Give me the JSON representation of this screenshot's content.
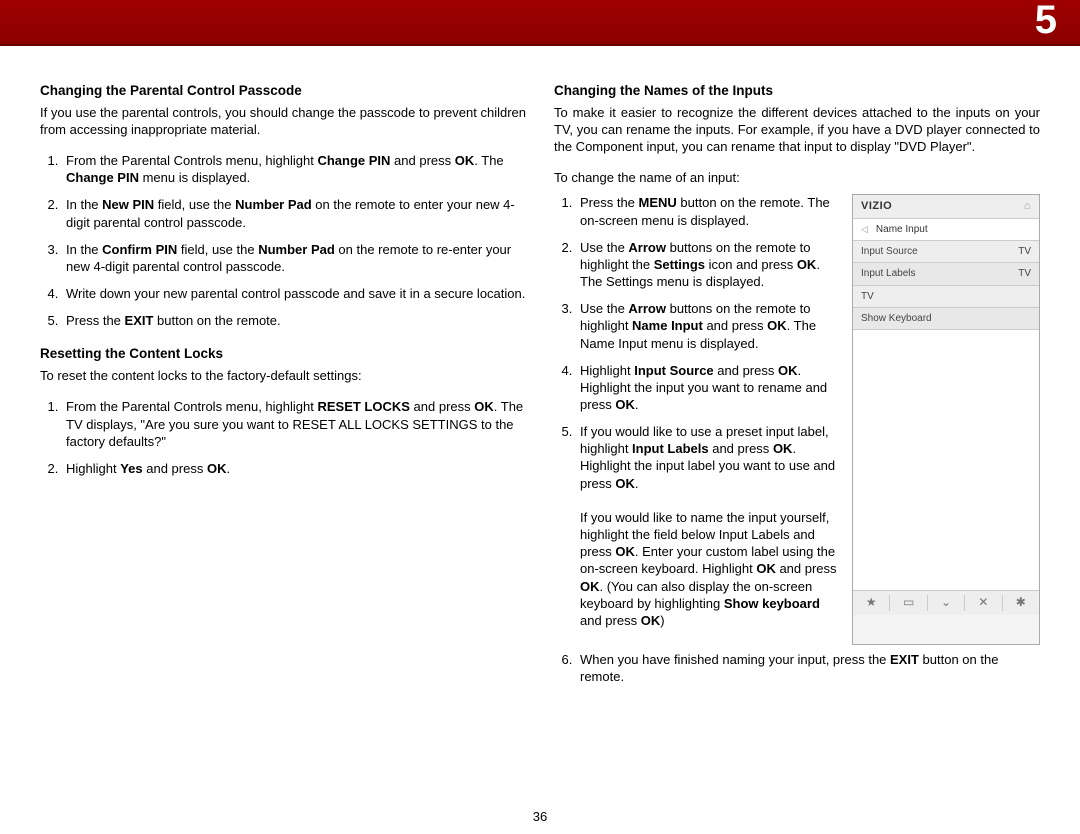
{
  "chapter_number": "5",
  "page_number": "36",
  "left": {
    "sec1_title": "Changing the Parental Control Passcode",
    "sec1_intro": "If you use the parental controls, you should change the passcode to prevent children from accessing inappropriate material.",
    "sec1_li1_a": "From the Parental Controls menu, highlight ",
    "sec1_li1_b": "Change PIN",
    "sec1_li1_c": " and press ",
    "sec1_li1_d": "OK",
    "sec1_li1_e": ". The ",
    "sec1_li1_f": "Change PIN",
    "sec1_li1_g": " menu is displayed.",
    "sec1_li2_a": "In the ",
    "sec1_li2_b": "New PIN",
    "sec1_li2_c": " field, use the ",
    "sec1_li2_d": "Number Pad",
    "sec1_li2_e": " on the remote to enter your new 4-digit parental control passcode.",
    "sec1_li3_a": "In the ",
    "sec1_li3_b": "Confirm PIN",
    "sec1_li3_c": " field, use the ",
    "sec1_li3_d": "Number Pad",
    "sec1_li3_e": " on the remote to re-enter your new 4-digit parental control passcode.",
    "sec1_li4": "Write down your new parental control passcode and save it in a secure location.",
    "sec1_li5_a": "Press the ",
    "sec1_li5_b": "EXIT",
    "sec1_li5_c": " button on the remote.",
    "sec2_title": "Resetting the Content Locks",
    "sec2_intro": "To reset the content locks to the factory-default settings:",
    "sec2_li1_a": "From the Parental Controls menu, highlight ",
    "sec2_li1_b": "RESET LOCKS",
    "sec2_li1_c": " and press ",
    "sec2_li1_d": "OK",
    "sec2_li1_e": ". The TV displays, \"Are you sure you want to RESET ALL LOCKS SETTINGS to the factory defaults?\"",
    "sec2_li2_a": "Highlight ",
    "sec2_li2_b": "Yes",
    "sec2_li2_c": " and press ",
    "sec2_li2_d": "OK",
    "sec2_li2_e": "."
  },
  "right": {
    "title": "Changing the Names of the Inputs",
    "intro": "To make it easier to recognize the different devices attached to the inputs on your TV, you can rename the inputs. For example, if you have a DVD player connected to the Component input, you can rename that input to display \"DVD Player\".",
    "lead": "To change the name of an input:",
    "li1_a": "Press the ",
    "li1_b": "MENU",
    "li1_c": " button on the remote. The on-screen menu is displayed.",
    "li2_a": "Use the ",
    "li2_b": "Arrow",
    "li2_c": " buttons on the remote to highlight the ",
    "li2_d": "Settings",
    "li2_e": " icon and press ",
    "li2_f": "OK",
    "li2_g": ". The Settings menu is displayed.",
    "li3_a": "Use the ",
    "li3_b": "Arrow",
    "li3_c": " buttons on the remote to highlight ",
    "li3_d": "Name Input",
    "li3_e": " and press ",
    "li3_f": "OK",
    "li3_g": ". The Name Input menu is displayed.",
    "li4_a": "Highlight ",
    "li4_b": "Input Source",
    "li4_c": " and press ",
    "li4_d": "OK",
    "li4_e": ". Highlight the input you want to rename and press ",
    "li4_f": "OK",
    "li4_g": ".",
    "li5_a": "If you would like to use a preset input label, highlight ",
    "li5_b": "Input Labels",
    "li5_c": " and press ",
    "li5_d": "OK",
    "li5_e": ". Highlight the input label you want to use and press ",
    "li5_f": "OK",
    "li5_g": ".",
    "li5p2_a": "If you would like to name the input yourself, highlight the field below Input Labels and press ",
    "li5p2_b": "OK",
    "li5p2_c": ". Enter your custom label using the on-screen keyboard. Highlight ",
    "li5p2_d": "OK",
    "li5p2_e": " and press ",
    "li5p2_f": "OK",
    "li5p2_g": ". (You can also display the on-screen keyboard by highlighting ",
    "li5p2_h": "Show keyboard",
    "li5p2_i": " and press ",
    "li5p2_j": "OK",
    "li5p2_k": ")",
    "li6_a": "When you have finished naming your input, press the ",
    "li6_b": "EXIT",
    "li6_c": " button on the remote."
  },
  "panel": {
    "brand": "VIZIO",
    "menu_title": "Name Input",
    "row1_label": "Input Source",
    "row1_val": "TV",
    "row2_label": "Input Labels",
    "row2_val": "TV",
    "row3_label": "TV",
    "row4_label": "Show Keyboard",
    "ftr_star": "★",
    "ftr_wide": "▭",
    "ftr_v": "⌄",
    "ftr_x": "✕",
    "ftr_gear": "✱"
  }
}
